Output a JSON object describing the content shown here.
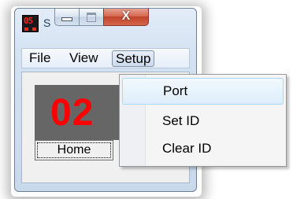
{
  "window": {
    "title_fragment": "S",
    "icon_digits": "05",
    "caption": {
      "minimize": "",
      "maximize": "",
      "close": "X"
    }
  },
  "menubar": {
    "items": [
      "File",
      "View",
      "Setup"
    ],
    "open": "Setup"
  },
  "display": {
    "value": "02",
    "color": "#ff0000",
    "background": "#666666"
  },
  "home_button": {
    "label": "Home"
  },
  "setup_menu": {
    "items": [
      "Port",
      "Set ID",
      "Clear ID"
    ],
    "highlighted": "Port"
  }
}
